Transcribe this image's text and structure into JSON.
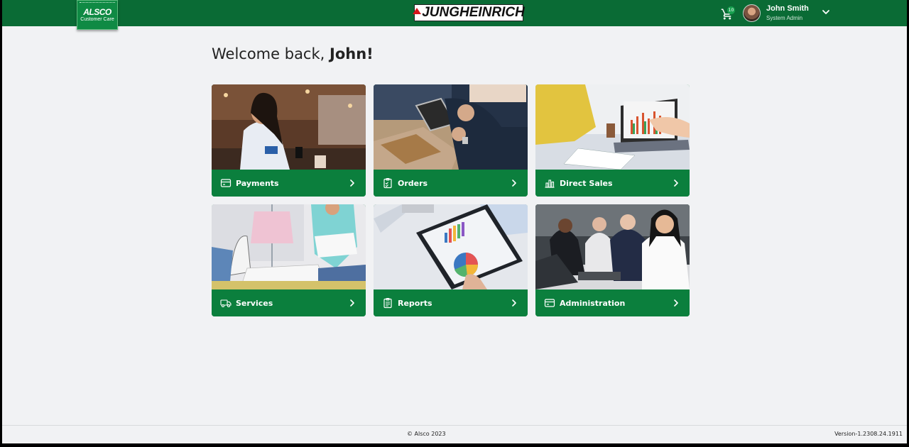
{
  "header": {
    "alsco_brand": "ALSCO",
    "alsco_sub": "Customer Care",
    "jungheinrich_brand": "JUNGHEINRICH",
    "cart_count": "10",
    "user_name": "John Smith",
    "user_role": "System Admin"
  },
  "main": {
    "welcome_prefix": "Welcome back, ",
    "welcome_name": "John!",
    "cards": [
      {
        "label": "Payments",
        "icon": "credit-card-icon"
      },
      {
        "label": "Orders",
        "icon": "clipboard-check-icon"
      },
      {
        "label": "Direct Sales",
        "icon": "bar-chart-icon"
      },
      {
        "label": "Services",
        "icon": "truck-icon"
      },
      {
        "label": "Reports",
        "icon": "clipboard-list-icon"
      },
      {
        "label": "Administration",
        "icon": "credit-card-icon"
      }
    ]
  },
  "footer": {
    "copyright": "© Alsco 2023",
    "version": "Version-1.2308.24.1911"
  },
  "colors": {
    "header_green": "#0a6b35",
    "card_green": "#0b7f3d",
    "background": "#f1f2f4"
  }
}
